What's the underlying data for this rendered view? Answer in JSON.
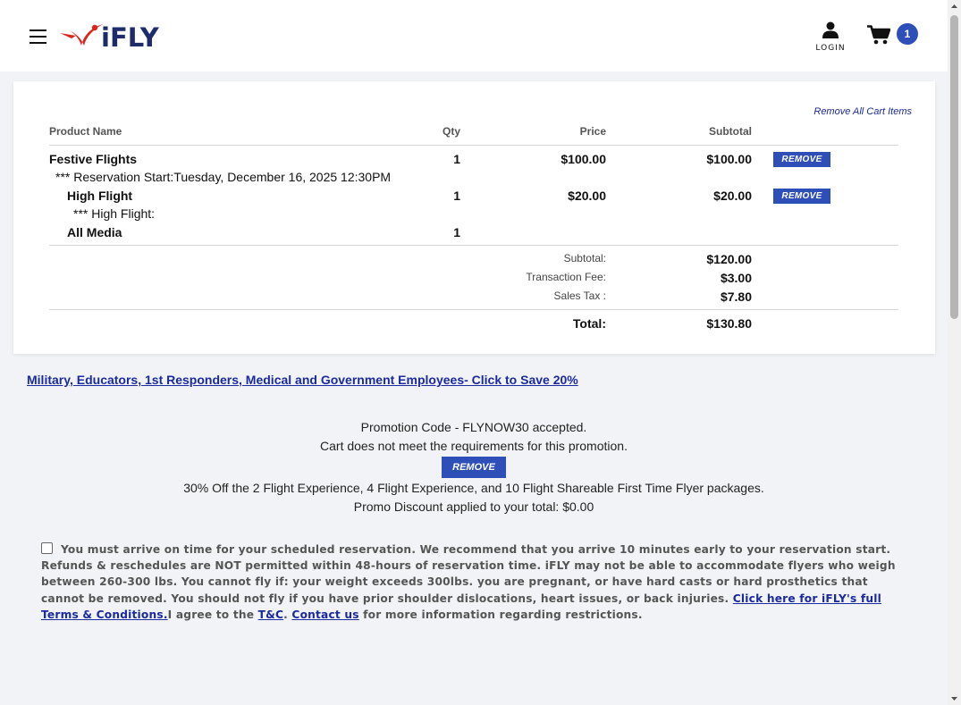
{
  "header": {
    "logo_text": "iFLY",
    "login_label": "LOGIN",
    "cart_count": "1"
  },
  "cart": {
    "remove_all_label": "Remove All Cart Items",
    "columns": {
      "product": "Product Name",
      "qty": "Qty",
      "price": "Price",
      "subtotal": "Subtotal"
    },
    "items": [
      {
        "name": "Festive Flights",
        "qty": "1",
        "price": "$100.00",
        "subtotal": "$100.00",
        "remove_label": "REMOVE",
        "detail": "*** Reservation Start:Tuesday, December 16, 2025 12:30PM"
      },
      {
        "name": "High Flight",
        "qty": "1",
        "price": "$20.00",
        "subtotal": "$20.00",
        "remove_label": "REMOVE",
        "detail": "*** High Flight:"
      },
      {
        "name": "All Media",
        "qty": "1"
      }
    ],
    "totals": {
      "subtotal_label": "Subtotal:",
      "subtotal": "$120.00",
      "fee_label": "Transaction Fee:",
      "fee": "$3.00",
      "tax_label": "Sales Tax :",
      "tax": "$7.80",
      "total_label": "Total:",
      "total": "$130.80"
    }
  },
  "promo": {
    "discount_link": "Military, Educators, 1st Responders, Medical and Government Employees- Click to Save 20%",
    "accepted": "Promotion Code - FLYNOW30 accepted.",
    "not_met": "Cart does not meet the requirements for this promotion.",
    "remove_label": "REMOVE",
    "description": "30% Off the 2 Flight Experience, 4 Flight Experience, and 10 Flight Shareable First Time Flyer packages.",
    "applied": "Promo Discount applied to your total: $0.00"
  },
  "terms": {
    "text": "You must arrive on time for your scheduled reservation. We recommend that you arrive 10 minutes early to your reservation start. Refunds & reschedules are NOT permitted within 48-hours of reservation time. iFLY may not be able to accommodate flyers who weigh between 260-300 lbs. You cannot fly if: your weight exceeds 300lbs. you are pregnant, or have hard casts or hard prosthetics that cannot be removed. You should not fly if you have prior shoulder dislocations, heart issues, or back injuries. ",
    "full_terms_link": "Click here for iFLY's full Terms & Conditions.",
    "agree_text": "I agree to the ",
    "tc_link": "T&C",
    "sep": ". ",
    "contact_link": "Contact us",
    "tail": " for more information regarding restrictions."
  },
  "colors": {
    "accent": "#2f4fb8",
    "link": "#1b2a9e",
    "logo_red": "#d9251c",
    "logo_navy": "#1f2c6b"
  }
}
